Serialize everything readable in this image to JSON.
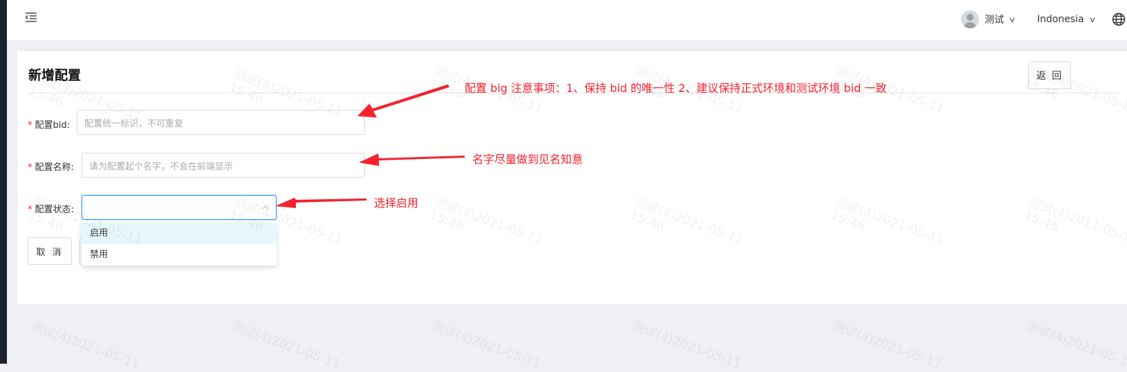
{
  "header": {
    "user_name": "测试",
    "language": "Indonesia"
  },
  "page": {
    "title": "新增配置",
    "back_label": "返 回"
  },
  "form": {
    "bid": {
      "label": "配置bid:",
      "placeholder": "配置统一标识，不可重复"
    },
    "name": {
      "label": "配置名称:",
      "placeholder": "请为配置起个名字，不会在前端显示"
    },
    "status": {
      "label": "配置状态:",
      "value": "",
      "options": [
        "启用",
        "禁用"
      ]
    },
    "cancel_label": "取 消"
  },
  "annotations": {
    "bid_note": "配置 big 注意事项：1、保持 bid 的唯一性 2、建议保持正式环境和测试环境 bid 一致",
    "name_note": "名字尽量做到见名知意",
    "status_note": "选择启用"
  },
  "watermark": {
    "line1": "测试(4)2021-05-11",
    "line2": "15:46"
  },
  "colors": {
    "accent": "#1890ff",
    "required": "#f5222d",
    "annotation": "#f5222d"
  },
  "icons": [
    "menu-fold-icon",
    "avatar-icon",
    "chevron-down-icon",
    "globe-icon",
    "chevron-up-icon"
  ]
}
